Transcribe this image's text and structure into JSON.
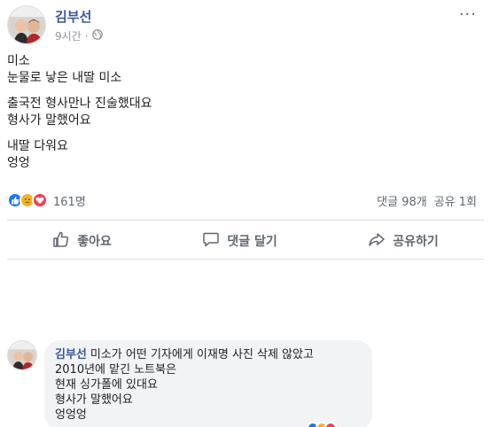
{
  "post": {
    "author": "김부선",
    "time": "9시간",
    "privacy_icon": "globe-icon",
    "more_icon": "ellipsis-icon",
    "more_label": "···",
    "lines": [
      "미소",
      "눈물로 낳은 내딸 미소",
      "출국전 형사만나 진술했대요",
      "형사가 말했어요",
      "내딸 다워요",
      "엉엉"
    ]
  },
  "reactions": {
    "icons": [
      "like-icon",
      "sad-icon",
      "love-icon"
    ],
    "count": "161명",
    "comments": "댓글 98개",
    "shares": "공유 1회"
  },
  "actions": {
    "like": "좋아요",
    "comment": "댓글 달기",
    "share": "공유하기"
  },
  "comment": {
    "author": "김부선",
    "text_first": "미소가 어떤 기자에게 이재명 사진 삭제 않았고",
    "lines": [
      "2010년에 맡긴 노트북은",
      "현재 싱가폴에 있대요",
      "형사가 말했어요",
      "엉엉엉"
    ]
  },
  "colors": {
    "brand_link": "#385898",
    "like_blue": "#1877f2",
    "love_red": "#f33e58",
    "sad_yellow": "#f7b125",
    "muted": "#606770"
  }
}
